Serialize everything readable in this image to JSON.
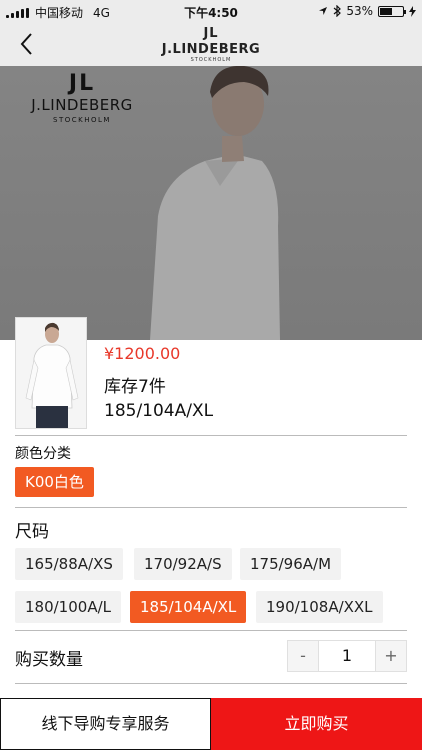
{
  "status_bar": {
    "carrier": "中国移动",
    "network": "4G",
    "time": "下午4:50",
    "battery_percent": "53%",
    "battery_level": 0.53
  },
  "nav": {
    "brand": "J.LINDEBERG",
    "brand_mark": "JL",
    "brand_sub": "STOCKHOLM"
  },
  "hero": {
    "brand": "J.LINDEBERG",
    "brand_mark": "JL",
    "brand_sub": "STOCKHOLM"
  },
  "product": {
    "price": "¥1200.00",
    "stock": "库存7件",
    "selected_size": "185/104A/XL"
  },
  "color": {
    "label": "颜色分类",
    "options": [
      {
        "label": "K00白色",
        "selected": true
      }
    ]
  },
  "size": {
    "label": "尺码",
    "options": [
      {
        "label": "165/88A/XS",
        "selected": false
      },
      {
        "label": "170/92A/S",
        "selected": false
      },
      {
        "label": "175/96A/M",
        "selected": false
      },
      {
        "label": "180/100A/L",
        "selected": false
      },
      {
        "label": "185/104A/XL",
        "selected": true
      },
      {
        "label": "190/108A/XXL",
        "selected": false
      }
    ]
  },
  "quantity": {
    "label": "购买数量",
    "decrement": "-",
    "value": "1",
    "increment": "+"
  },
  "actions": {
    "service_label": "线下导购专享服务",
    "buy_label": "立即购买"
  },
  "colors": {
    "accent": "#f25a22",
    "price": "#e8382a",
    "buy_button": "#ee1616"
  }
}
